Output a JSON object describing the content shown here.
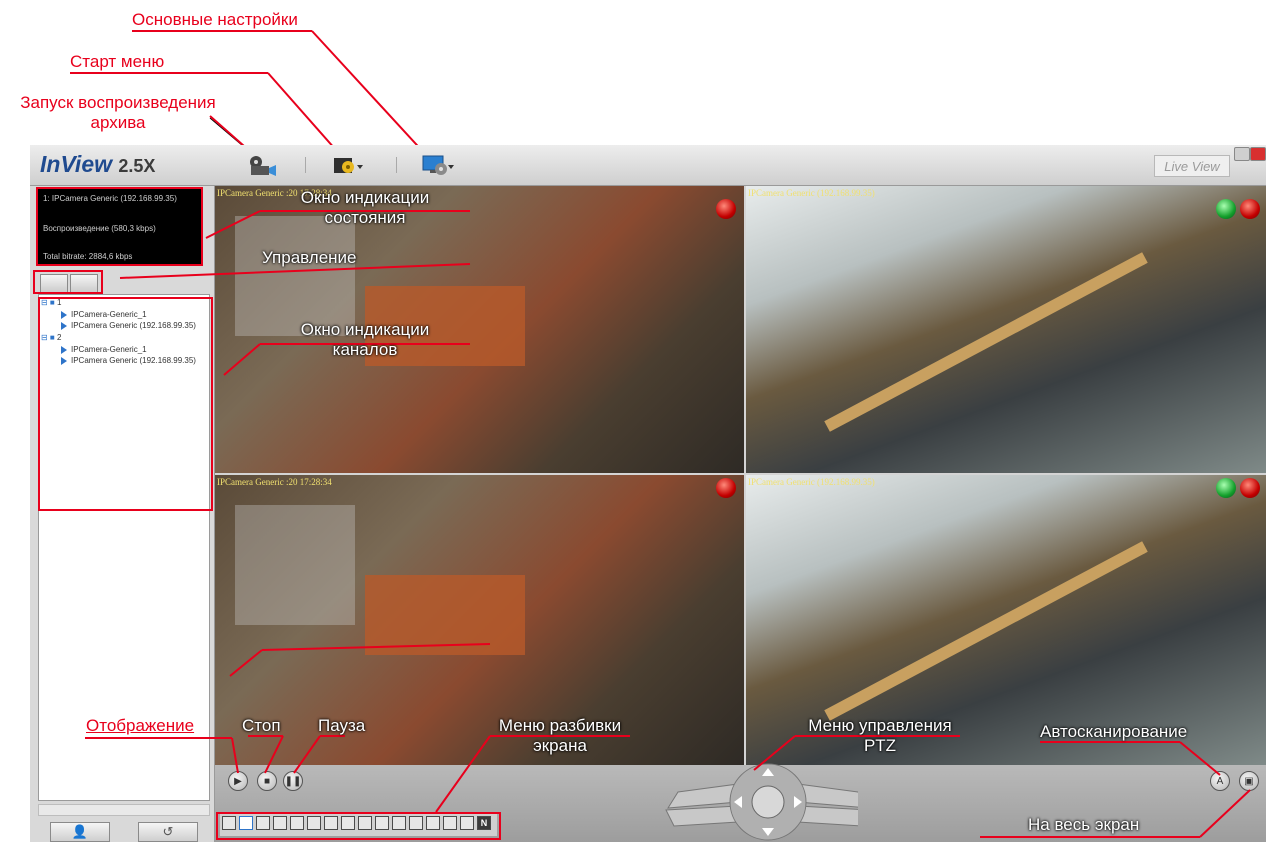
{
  "callouts": {
    "osnovnye": "Основные настройки",
    "start_menu": "Старт меню",
    "zapusk_1": "Запуск воспроизведения",
    "zapusk_2": "архива",
    "okno_sost_1": "Окно индикации",
    "okno_sost_2": "состояния",
    "upravlenie": "Управление",
    "okno_kan_1": "Окно индикации",
    "okno_kan_2": "каналов",
    "otobrazhenie": "Отображение",
    "stop": "Стоп",
    "pauza": "Пауза",
    "menu_razb_1": "Меню разбивки",
    "menu_razb_2": "экрана",
    "menu_ptz_1": "Меню управления",
    "menu_ptz_2": "PTZ",
    "avtoscan": "Автосканирование",
    "ves_ekran": "На весь экран"
  },
  "app": {
    "logo": "InView",
    "version": "2.5X",
    "live_view": "Live View",
    "toolbar": {
      "playback_icon": "film-camera-icon",
      "start_menu_icon": "gear-menu-icon",
      "settings_icon": "monitor-gear-icon"
    }
  },
  "status": {
    "line1": "1: IPCamera Generic (192.168.99.35)",
    "line2": "Воспроизведение (580,3 kbps)",
    "line3": "Total bitrate: 2884,6 kbps"
  },
  "tree": {
    "groups": [
      {
        "label": "1",
        "items": [
          "IPCamera-Generic_1",
          "IPCamera Generic (192.168.99.35)"
        ]
      },
      {
        "label": "2",
        "items": [
          "IPCamera-Generic_1",
          "IPCamera Generic (192.168.99.35)"
        ]
      }
    ]
  },
  "cameras": [
    {
      "osd": "IPCamera Generic  :20 17:28:34"
    },
    {
      "osd": "IPCamera Generic (192.168.99.35)"
    },
    {
      "osd": "IPCamera Generic  :20 17:28:34"
    },
    {
      "osd": "IPCamera Generic (192.168.99.35)"
    }
  ],
  "split_last": "N"
}
